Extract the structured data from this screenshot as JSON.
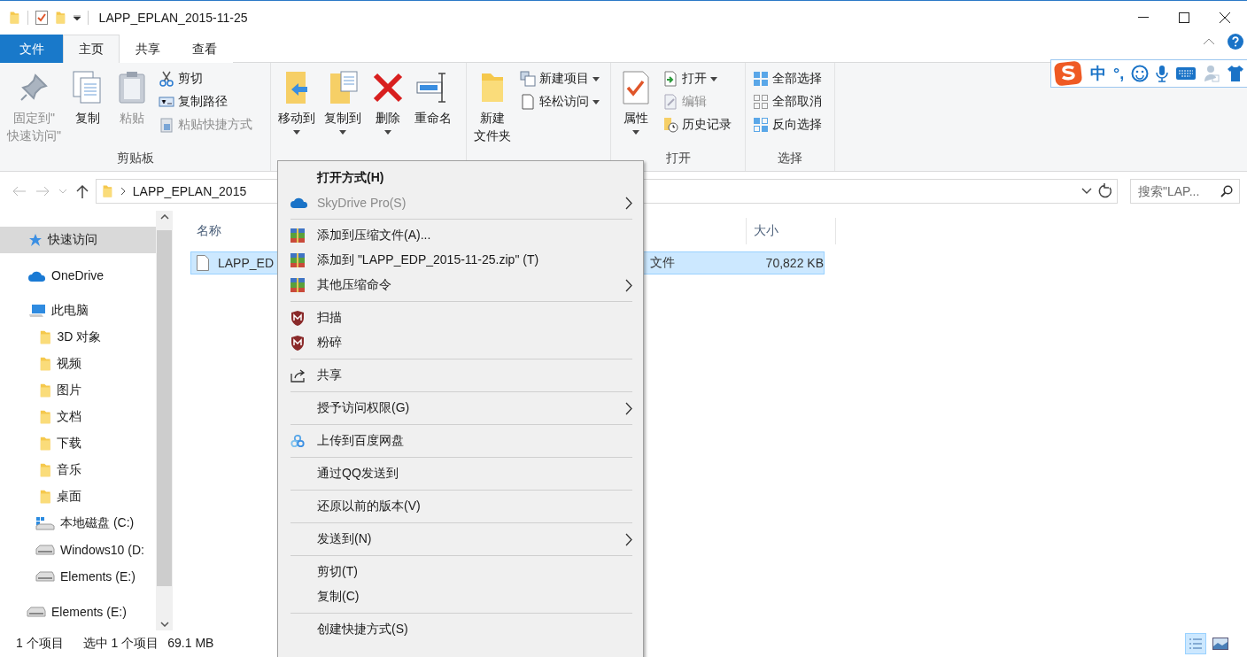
{
  "window": {
    "title": "LAPP_EPLAN_2015-11-25"
  },
  "ribbon_tabs": [
    {
      "label": "文件",
      "kind": "file",
      "selected": false
    },
    {
      "label": "主页",
      "kind": "tab",
      "selected": true
    },
    {
      "label": "共享",
      "kind": "tab",
      "selected": false
    },
    {
      "label": "查看",
      "kind": "tab",
      "selected": false
    }
  ],
  "ime_bar": {
    "mode": "中",
    "punctuation": "°,"
  },
  "ribbon_groups": [
    {
      "label": "剪贴板",
      "items": [
        {
          "kind": "large",
          "lines": [
            "固定到\"",
            "快速访问\""
          ],
          "disabled": true,
          "dropdown": false
        },
        {
          "kind": "large",
          "label": "复制",
          "disabled": false,
          "dropdown": false
        },
        {
          "kind": "large",
          "label": "粘贴",
          "disabled": true,
          "dropdown": false
        },
        {
          "kind": "small",
          "label": "剪切",
          "disabled": false,
          "dropdown": false
        },
        {
          "kind": "small",
          "label": "复制路径",
          "disabled": false,
          "dropdown": false
        },
        {
          "kind": "small",
          "label": "粘贴快捷方式",
          "disabled": true,
          "dropdown": false
        }
      ]
    },
    {
      "items": [
        {
          "kind": "large",
          "label": "移动到",
          "disabled": false,
          "dropdown": true
        },
        {
          "kind": "large",
          "label": "复制到",
          "disabled": false,
          "dropdown": true
        },
        {
          "kind": "large",
          "label": "删除",
          "disabled": false,
          "dropdown": true
        },
        {
          "kind": "large",
          "label": "重命名",
          "disabled": false,
          "dropdown": false
        }
      ]
    },
    {
      "items": [
        {
          "kind": "large",
          "lines": [
            "新建",
            "文件夹"
          ],
          "disabled": false,
          "dropdown": false
        },
        {
          "kind": "small",
          "label": "新建项目",
          "disabled": false,
          "dropdown": true
        },
        {
          "kind": "small",
          "label": "轻松访问",
          "disabled": false,
          "dropdown": true
        }
      ]
    },
    {
      "label": "打开",
      "items": [
        {
          "kind": "large",
          "label": "属性",
          "disabled": false,
          "dropdown": true
        },
        {
          "kind": "small",
          "label": "打开",
          "disabled": false,
          "dropdown": true
        },
        {
          "kind": "small",
          "label": "编辑",
          "disabled": true,
          "dropdown": false
        },
        {
          "kind": "small",
          "label": "历史记录",
          "disabled": false,
          "dropdown": false
        }
      ]
    },
    {
      "label": "选择",
      "items": [
        {
          "kind": "small",
          "label": "全部选择",
          "disabled": false,
          "dropdown": false
        },
        {
          "kind": "small",
          "label": "全部取消",
          "disabled": false,
          "dropdown": false
        },
        {
          "kind": "small",
          "label": "反向选择",
          "disabled": false,
          "dropdown": false
        }
      ]
    }
  ],
  "address_bar": {
    "path": "LAPP_EPLAN_2015"
  },
  "search": {
    "placeholder": "搜索\"LAP..."
  },
  "sidebar": {
    "items": [
      {
        "label": "快速访问",
        "kind": "quick",
        "selected": true
      },
      {
        "label": "OneDrive",
        "kind": "cloud",
        "selected": false
      },
      {
        "label": "此电脑",
        "kind": "pc",
        "selected": false,
        "children": [
          {
            "label": "3D 对象",
            "kind": "folder",
            "selected": false
          },
          {
            "label": "视频",
            "kind": "folder",
            "selected": false
          },
          {
            "label": "图片",
            "kind": "folder",
            "selected": false
          },
          {
            "label": "文档",
            "kind": "folder",
            "selected": false
          },
          {
            "label": "下载",
            "kind": "folder",
            "selected": false
          },
          {
            "label": "音乐",
            "kind": "folder",
            "selected": false
          },
          {
            "label": "桌面",
            "kind": "folder",
            "selected": false
          },
          {
            "label": "本地磁盘 (C:)",
            "kind": "windrive",
            "selected": false
          },
          {
            "label": "Windows10 (D:",
            "kind": "drive",
            "selected": false
          },
          {
            "label": "Elements (E:)",
            "kind": "drive",
            "selected": false
          }
        ]
      },
      {
        "label": "Elements (E:)",
        "kind": "drive",
        "selected": false
      }
    ]
  },
  "file_list": {
    "columns": [
      "名称",
      "大小"
    ],
    "rows": [
      {
        "name": "LAPP_ED",
        "type": "文件",
        "size": "70,822 KB",
        "selected": true
      }
    ]
  },
  "context_menu": {
    "groups": [
      [
        {
          "label": "打开方式(H)",
          "kind": "none",
          "default": true,
          "disabled": false,
          "submenu": false
        },
        {
          "label": "SkyDrive Pro(S)",
          "kind": "cloud",
          "default": false,
          "disabled": true,
          "submenu": true
        }
      ],
      [
        {
          "label": "添加到压缩文件(A)...",
          "kind": "archive",
          "default": false,
          "disabled": false,
          "submenu": false
        },
        {
          "label": "添加到 \"LAPP_EDP_2015-11-25.zip\" (T)",
          "kind": "archive",
          "default": false,
          "disabled": false,
          "submenu": false
        },
        {
          "label": "其他压缩命令",
          "kind": "archive",
          "default": false,
          "disabled": false,
          "submenu": true
        }
      ],
      [
        {
          "label": "扫描",
          "kind": "shield",
          "default": false,
          "disabled": false,
          "submenu": false
        },
        {
          "label": "粉碎",
          "kind": "shield",
          "default": false,
          "disabled": false,
          "submenu": false
        }
      ],
      [
        {
          "label": "共享",
          "kind": "share",
          "default": false,
          "disabled": false,
          "submenu": false
        }
      ],
      [
        {
          "label": "授予访问权限(G)",
          "kind": "none",
          "default": false,
          "disabled": false,
          "submenu": true
        }
      ],
      [
        {
          "label": "上传到百度网盘",
          "kind": "baidu",
          "default": false,
          "disabled": false,
          "submenu": false
        }
      ],
      [
        {
          "label": "通过QQ发送到",
          "kind": "none",
          "default": false,
          "disabled": false,
          "submenu": false
        }
      ],
      [
        {
          "label": "还原以前的版本(V)",
          "kind": "none",
          "default": false,
          "disabled": false,
          "submenu": false
        }
      ],
      [
        {
          "label": "发送到(N)",
          "kind": "none",
          "default": false,
          "disabled": false,
          "submenu": true
        }
      ],
      [
        {
          "label": "剪切(T)",
          "kind": "none",
          "default": false,
          "disabled": false,
          "submenu": false
        },
        {
          "label": "复制(C)",
          "kind": "none",
          "default": false,
          "disabled": false,
          "submenu": false
        }
      ],
      [
        {
          "label": "创建快捷方式(S)",
          "kind": "none",
          "default": false,
          "disabled": false,
          "submenu": false
        }
      ]
    ]
  },
  "status_bar": {
    "count": "1 个项目",
    "selection": "选中 1 个项目",
    "size": "69.1 MB",
    "views": [
      {
        "kind": "details",
        "selected": true
      },
      {
        "kind": "thumbnails",
        "selected": false
      }
    ]
  }
}
